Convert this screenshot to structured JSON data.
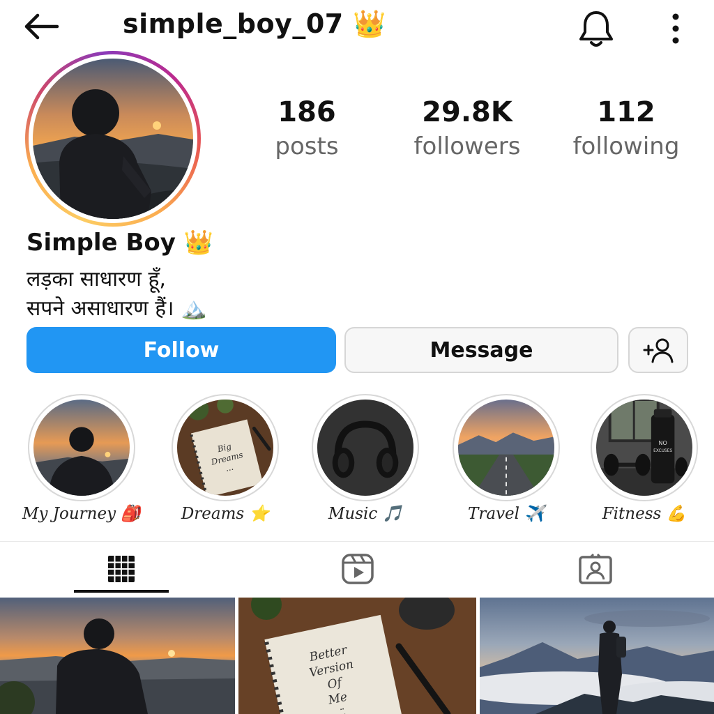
{
  "header": {
    "username": "simple_boy_07 👑"
  },
  "stats": {
    "posts_value": "186",
    "posts_label": "posts",
    "followers_value": "29.8K",
    "followers_label": "followers",
    "following_value": "112",
    "following_label": "following"
  },
  "profile": {
    "display_name": "Simple Boy 👑",
    "bio_line_1": "लड़का साधारण हूँ,",
    "bio_line_2": "सपने असाधारण हैं। 🏔️"
  },
  "actions": {
    "follow_label": "Follow",
    "message_label": "Message"
  },
  "highlights": [
    {
      "label": "My Journey 🎒"
    },
    {
      "label": "Dreams ⭐"
    },
    {
      "label": "Music 🎵"
    },
    {
      "label": "Travel ✈️"
    },
    {
      "label": "Fitness 💪"
    }
  ],
  "highlight_art": {
    "dreams_note_line_1": "Big",
    "dreams_note_line_2": "Dreams",
    "dreams_note_line_3": "...",
    "fitness_bottle_line_1": "NO",
    "fitness_bottle_line_2": "EXCUSES"
  },
  "posts_art": {
    "notebook_line_1": "Better",
    "notebook_line_2": "Version",
    "notebook_line_3": "Of",
    "notebook_line_4": "Me",
    "notebook_line_5": "◡̈"
  },
  "colors": {
    "follow_button": "#2196f3",
    "story_ring": "#cd486b",
    "text_secondary": "#666666"
  },
  "icons": {
    "back": "back-arrow-icon",
    "bell": "bell-icon",
    "more": "more-vertical-icon",
    "add_user": "add-user-icon",
    "grid_tab": "grid-icon",
    "reels_tab": "reels-icon",
    "tagged_tab": "tagged-icon"
  }
}
